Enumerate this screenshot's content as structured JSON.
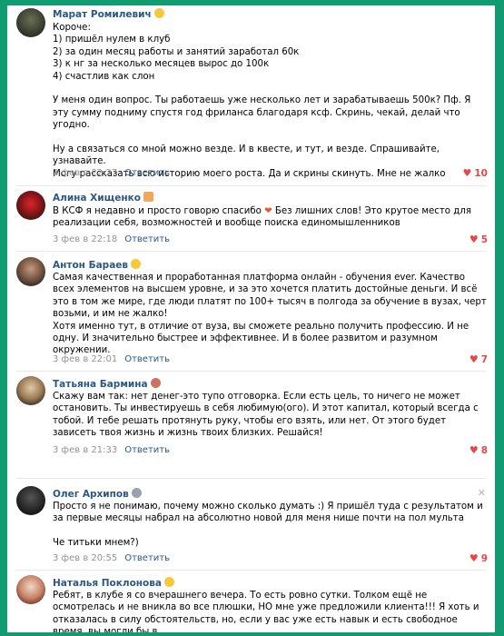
{
  "comments": [
    {
      "author": "Марат Ромилевич",
      "text": "Короче:\n1) пришёл нулем в клуб\n2) за один месяц работы и занятий заработал 60к\n3) к нг за несколько месяцев вырос до 100к\n4) счастлив как слон\n\nУ меня один вопрос. Ты работаешь уже несколько лет и зарабатываешь 500к? Пф. Я эту сумму подниму спустя год фриланса благодаря ксф. Скринь, чекай, делай что угодно.\n\nНу а связаться со мной можно везде. И в квесте, и тут, и везде. Спрашивайте, узнавайте.\nМогу рассказать всю историю моего роста. Да и скрины скинуть. Мне не жалко",
      "date": "3 фев в 22:27",
      "reply": "Ответить",
      "likes": "10"
    },
    {
      "author": "Алина Хищенко",
      "text_before_emoji": "В КСФ я недавно и просто говорю спасибо ",
      "text_after_emoji": " Без лишних слов! Это крутое место для реализации себя, возможностей и вообще поиска единомышленников",
      "date": "3 фев в 22:18",
      "reply": "Ответить",
      "likes": "5"
    },
    {
      "author": "Антон Бараев",
      "text": "Самая качественная и проработанная платформа онлайн - обучения ever. Качество всех элементов на высшем уровне, и за это хочется платить достойные деньги. И всё это в том же мире, где люди платят по 100+ тысяч в полгода за обучение в вузах, черт возьми, и им не жалко!\nХотя именно тут, в отличие от вуза, вы сможете реально получить профессию. И не одну. И значительно быстрее и эффективнее. И в более развитом и разумном окружении.",
      "date": "3 фев в 22:01",
      "reply": "Ответить",
      "likes": "7"
    },
    {
      "author": "Татьяна Бармина",
      "text": "Скажу вам так: нет денег-это тупо отговорка. Если есть цель, то ничего не может остановить. Ты инвестируешь в себя любимую(ого). И этот капитал, который всегда с тобой. И тебе решать протянуть руку, чтобы его взять, или нет. От этого будет зависеть твоя жизнь и жизнь твоих близких. Решайся!",
      "date": "3 фев в 21:33",
      "reply": "Ответить",
      "likes": "8"
    },
    {
      "author": "Олег Архипов",
      "text": "Просто я не понимаю, почему можно сколько думать :) Я пришёл туда с результатом и за первые месяцы набрал на абсолютно новой для меня нише почти на пол мульта\n\nЧе титьки мнем?)",
      "date": "3 фев в 20:55",
      "reply": "Ответить",
      "likes": "9"
    },
    {
      "author": "Наталья Поклонова",
      "text": "Ребят, в клубе я со вчерашнего вечера. То есть ровно сутки. Толком ещё не осмотрелась и не вникла во все плюшки, НО мне уже предложили клиента!!! Я хоть и отказалась в силу обстоятельств, но, если у вас уже есть навык и есть свободное время, вы могли бы в"
    }
  ],
  "icons": {
    "like": "heart-icon",
    "close": "close-icon"
  },
  "colors": {
    "frame": "#109b70",
    "author": "#2a5885",
    "likes": "#e64646",
    "meta": "#939393"
  }
}
